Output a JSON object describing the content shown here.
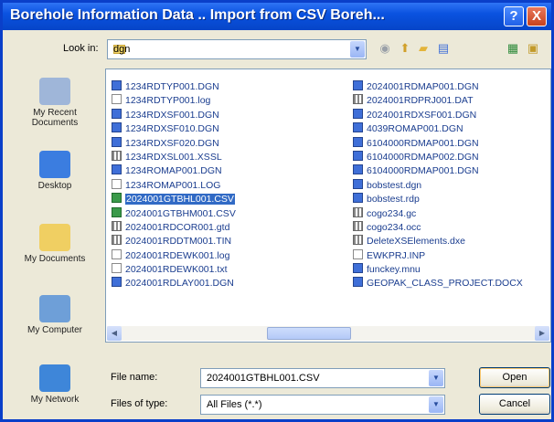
{
  "window": {
    "title": "Borehole Information Data .. Import from CSV Boreh...",
    "help": "?",
    "close": "X"
  },
  "toolbar": {
    "look_in_label": "Look in:",
    "look_in_value": "dgn",
    "dropdown_glyph": "▼"
  },
  "places": [
    {
      "label": "My Recent Documents",
      "icon": "recent-documents-icon",
      "color": "#9fb6d9"
    },
    {
      "label": "Desktop",
      "icon": "desktop-icon",
      "color": "#3b7de0"
    },
    {
      "label": "My Documents",
      "icon": "my-documents-icon",
      "color": "#f0cf62"
    },
    {
      "label": "My Computer",
      "icon": "my-computer-icon",
      "color": "#6e9fd8"
    },
    {
      "label": "My Network",
      "icon": "my-network-icon",
      "color": "#3e86d9"
    }
  ],
  "files_left": [
    {
      "name": "1234RDTYP001.DGN",
      "type": "dgn"
    },
    {
      "name": "1234RDTYP001.log",
      "type": "txt"
    },
    {
      "name": "1234RDXSF001.DGN",
      "type": "dgn"
    },
    {
      "name": "1234RDXSF010.DGN",
      "type": "dgn"
    },
    {
      "name": "1234RDXSF020.DGN",
      "type": "dgn"
    },
    {
      "name": "1234RDXSL001.XSSL",
      "type": "grid"
    },
    {
      "name": "1234ROMAP001.DGN",
      "type": "dgn"
    },
    {
      "name": "1234ROMAP001.LOG",
      "type": "txt"
    },
    {
      "name": "2024001GTBHL001.CSV",
      "type": "xls",
      "selected": true
    },
    {
      "name": "2024001GTBHM001.CSV",
      "type": "xls"
    },
    {
      "name": "2024001RDCOR001.gtd",
      "type": "grid"
    },
    {
      "name": "2024001RDDTM001.TIN",
      "type": "grid"
    },
    {
      "name": "2024001RDEWK001.log",
      "type": "txt"
    },
    {
      "name": "2024001RDEWK001.txt",
      "type": "txt"
    },
    {
      "name": "2024001RDLAY001.DGN",
      "type": "dgn"
    }
  ],
  "files_right": [
    {
      "name": "2024001RDMAP001.DGN",
      "type": "dgn"
    },
    {
      "name": "2024001RDPRJ001.DAT",
      "type": "grid"
    },
    {
      "name": "2024001RDXSF001.DGN",
      "type": "dgn"
    },
    {
      "name": "4039ROMAP001.DGN",
      "type": "dgn"
    },
    {
      "name": "6104000RDMAP001.DGN",
      "type": "dgn"
    },
    {
      "name": "6104000RDMAP002.DGN",
      "type": "dgn"
    },
    {
      "name": "6104000RDMAP001.DGN",
      "type": "dgn"
    },
    {
      "name": "bobstest.dgn",
      "type": "dgn"
    },
    {
      "name": "bobstest.rdp",
      "type": "dgn"
    },
    {
      "name": "cogo234.gc",
      "type": "grid"
    },
    {
      "name": "cogo234.occ",
      "type": "grid"
    },
    {
      "name": "DeleteXSElements.dxe",
      "type": "grid"
    },
    {
      "name": "EWKPRJ.INP",
      "type": "txt"
    },
    {
      "name": "funckey.mnu",
      "type": "dgn"
    },
    {
      "name": "GEOPAK_CLASS_PROJECT.DOCX",
      "type": "dgn"
    }
  ],
  "scroll": {
    "left": "◀",
    "right": "▶"
  },
  "form": {
    "file_name_label": "File name:",
    "file_name_value": "2024001GTBHL001.CSV",
    "file_type_label": "Files of type:",
    "file_type_value": "All Files (*.*)",
    "open_label": "Open",
    "cancel_label": "Cancel"
  }
}
